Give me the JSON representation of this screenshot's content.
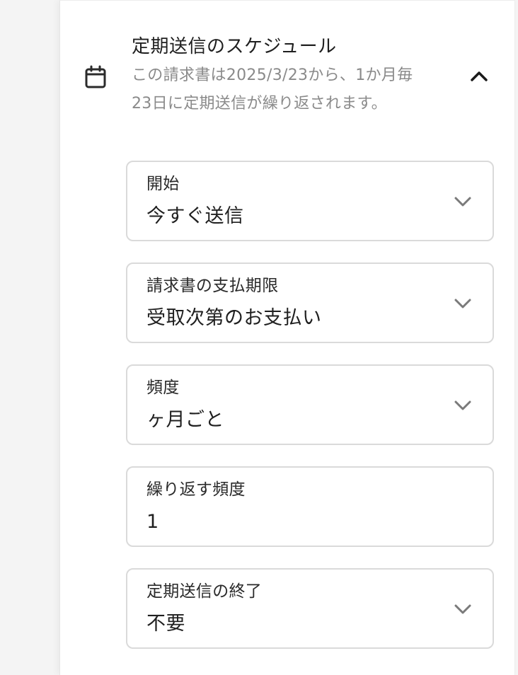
{
  "schedule": {
    "title": "定期送信のスケジュール",
    "description_line1": "この請求書は2025/3/23から、1か月毎",
    "description_line2": "23日に定期送信が繰り返されます。",
    "icon": "calendar-icon",
    "collapse_icon": "chevron-up-icon"
  },
  "fields": {
    "start": {
      "label": "開始",
      "value": "今すぐ送信",
      "icon": "chevron-down-icon"
    },
    "due": {
      "label": "請求書の支払期限",
      "value": "受取次第のお支払い",
      "icon": "chevron-down-icon"
    },
    "frequency": {
      "label": "頻度",
      "value": "ヶ月ごと",
      "icon": "chevron-down-icon"
    },
    "repeat": {
      "label": "繰り返す頻度",
      "value": "1"
    },
    "end": {
      "label": "定期送信の終了",
      "value": "不要",
      "icon": "chevron-down-icon"
    }
  },
  "colors": {
    "text_primary": "#1f1f1f",
    "text_secondary": "#8a8a8a",
    "border": "#dadada",
    "background": "#f4f4f4",
    "panel": "#ffffff"
  }
}
